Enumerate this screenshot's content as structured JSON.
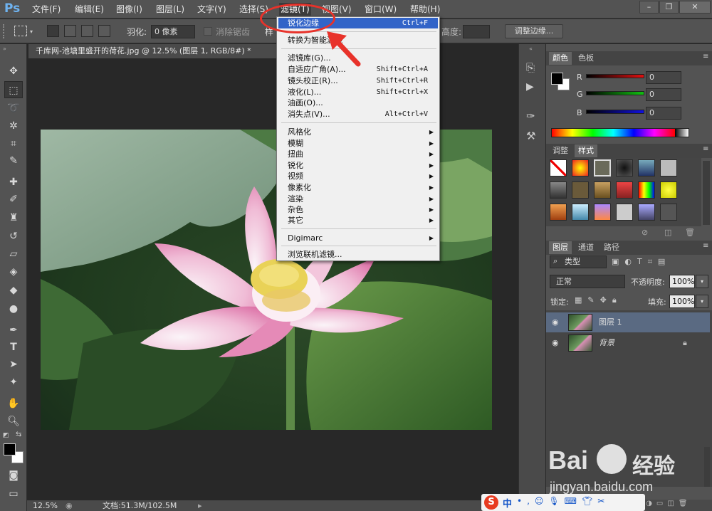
{
  "app": {
    "logo": "Ps",
    "doc_title": "千库网-池塘里盛开的荷花.jpg @ 12.5% (图层 1, RGB/8#) *",
    "accent": "#3264c8",
    "annotation_color": "#e8322a"
  },
  "menubar": {
    "items": [
      "文件(F)",
      "编辑(E)",
      "图像(I)",
      "图层(L)",
      "文字(Y)",
      "选择(S)",
      "滤镜(T)",
      "视图(V)",
      "窗口(W)",
      "帮助(H)"
    ],
    "window_controls": [
      "minimize-icon",
      "restore-icon",
      "close-icon"
    ]
  },
  "options": {
    "feather_label": "羽化:",
    "feather_value": "0 像素",
    "antialias_label": "消除锯齿",
    "style_label": "样",
    "height_label": "高度:",
    "refine_edge_button": "调整边缘..."
  },
  "filter_menu": {
    "items": [
      {
        "label": "锐化边缘",
        "shortcut": "Ctrl+F",
        "highlighted": true
      },
      {
        "label": "转换为智能滤镜"
      },
      {
        "label": "滤镜库(G)..."
      },
      {
        "label": "自适应广角(A)...",
        "shortcut": "Shift+Ctrl+A"
      },
      {
        "label": "镜头校正(R)...",
        "shortcut": "Shift+Ctrl+R"
      },
      {
        "label": "液化(L)...",
        "shortcut": "Shift+Ctrl+X"
      },
      {
        "label": "油画(O)..."
      },
      {
        "label": "消失点(V)...",
        "shortcut": "Alt+Ctrl+V"
      },
      {
        "label": "风格化",
        "submenu": true
      },
      {
        "label": "模糊",
        "submenu": true
      },
      {
        "label": "扭曲",
        "submenu": true
      },
      {
        "label": "锐化",
        "submenu": true
      },
      {
        "label": "视频",
        "submenu": true
      },
      {
        "label": "像素化",
        "submenu": true
      },
      {
        "label": "渲染",
        "submenu": true
      },
      {
        "label": "杂色",
        "submenu": true
      },
      {
        "label": "其它",
        "submenu": true
      },
      {
        "label": "Digimarc",
        "submenu": true
      },
      {
        "label": "浏览联机滤镜..."
      }
    ]
  },
  "status": {
    "zoom": "12.5%",
    "doc_size": "文档:51.3M/102.5M"
  },
  "color_panel": {
    "tabs": [
      "颜色",
      "色板"
    ],
    "channels": [
      {
        "label": "R",
        "value": "0",
        "color": "#d01818"
      },
      {
        "label": "G",
        "value": "0",
        "color": "#18b018"
      },
      {
        "label": "B",
        "value": "0",
        "color": "#1818d0"
      }
    ]
  },
  "styles_panel": {
    "tabs": [
      "调整",
      "样式"
    ]
  },
  "layers_panel": {
    "tabs": [
      "图层",
      "通道",
      "路径"
    ],
    "filter_label": "类型",
    "blend_mode": "正常",
    "opacity_label": "不透明度:",
    "opacity_value": "100%",
    "lock_label": "锁定:",
    "fill_label": "填充:",
    "fill_value": "100%",
    "layers": [
      {
        "name": "图层 1",
        "selected": true
      },
      {
        "name": "背景",
        "locked": true
      }
    ]
  },
  "watermark": {
    "brand": "Bai",
    "brand2": "经验",
    "url": "jingyan.baidu.com"
  },
  "taskbar": {
    "ime": "中"
  }
}
